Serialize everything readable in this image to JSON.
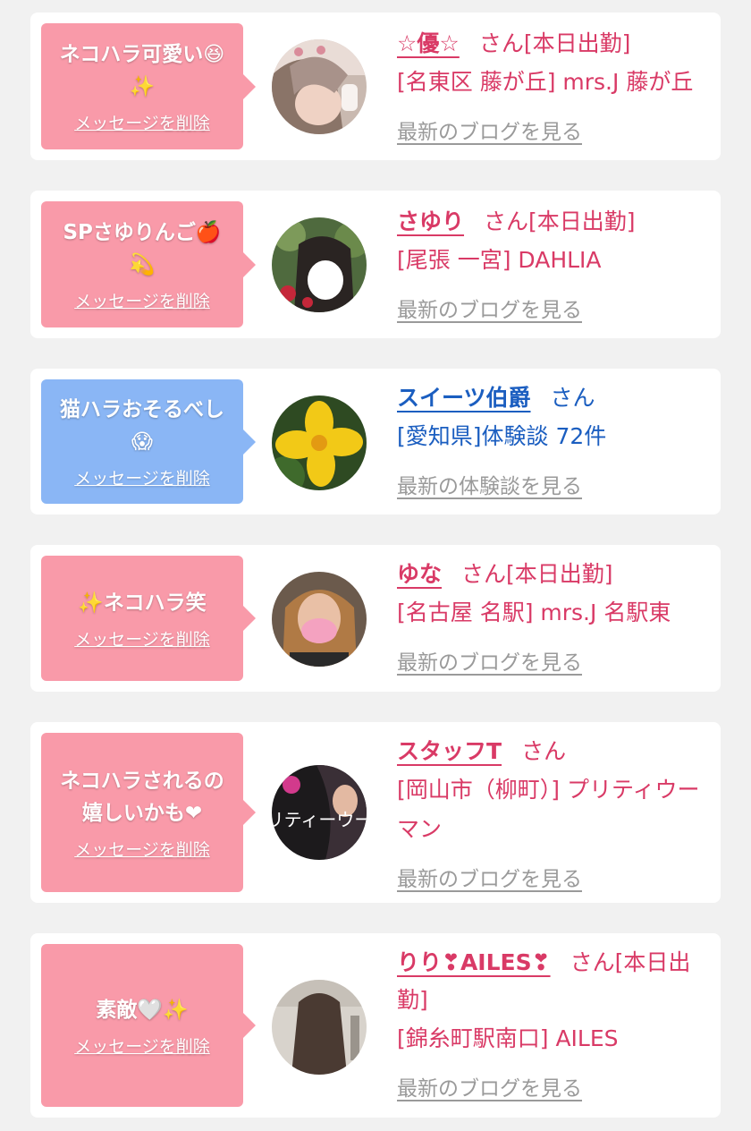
{
  "colors": {
    "background": "#f1f1f1",
    "card": "#ffffff",
    "bubble_pink": "#f99aa9",
    "bubble_blue": "#8ab6f5",
    "text_pink": "#d93a66",
    "text_blue": "#1b5ec0",
    "link_gray": "#9a9a9a"
  },
  "delete_label": "メッセージを削除",
  "items": [
    {
      "message": "ネコハラ可愛い😆\n✨",
      "name": "☆優☆",
      "suffix": "さん[本日出勤]",
      "shop": "[名東区 藤が丘] mrs.J 藤が丘",
      "link": "最新のブログを見る",
      "bubble_color": "pink"
    },
    {
      "message": "SPさゆりんご🍎\n💫",
      "name": "さゆり",
      "suffix": "さん[本日出勤]",
      "shop": "[尾張 一宮] DAHLIA",
      "link": "最新のブログを見る",
      "bubble_color": "pink"
    },
    {
      "message": "猫ハラおそるべし\n😱",
      "name": "スイーツ伯爵",
      "suffix": "さん",
      "shop": "[愛知県]体験談 72件",
      "link": "最新の体験談を見る",
      "bubble_color": "blue"
    },
    {
      "message": "✨ネコハラ笑",
      "name": "ゆな",
      "suffix": "さん[本日出勤]",
      "shop": "[名古屋 名駅] mrs.J 名駅東",
      "link": "最新のブログを見る",
      "bubble_color": "pink"
    },
    {
      "message": "ネコハラされるの\n嬉しいかも❤",
      "name": "スタッフT",
      "suffix": "さん",
      "shop": "[岡山市（柳町）] プリティウーマン",
      "link": "最新のブログを見る",
      "bubble_color": "pink",
      "avatar_text": "プリティーウーマ"
    },
    {
      "message": "素敵🤍✨",
      "name": "りり❣AILES❣",
      "suffix": "さん[本日出勤]",
      "shop": "[錦糸町駅南口] AILES",
      "link": "最新のブログを見る",
      "bubble_color": "pink"
    }
  ]
}
